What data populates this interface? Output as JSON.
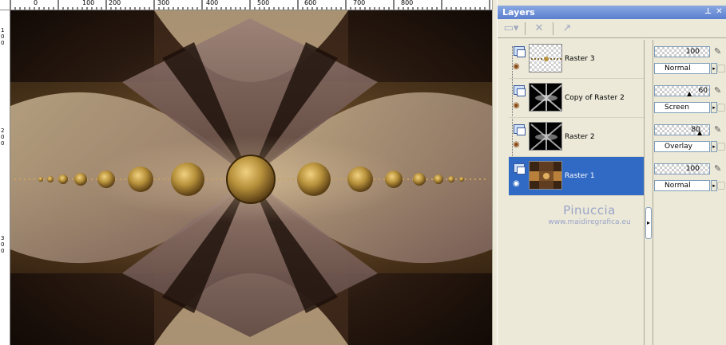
{
  "ruler": {
    "top_labels": [
      "0",
      "100",
      "200",
      "300",
      "400",
      "500",
      "600",
      "700",
      "800"
    ],
    "left_labels": [
      "1",
      "0",
      "0",
      "2",
      "0",
      "0",
      "3",
      "0",
      "0"
    ]
  },
  "panel": {
    "title": "Layers",
    "pin_icon": "pin-icon",
    "close_icon": "close-icon"
  },
  "toolbar": {
    "buttons": [
      "new-layer-icon",
      "delete-layer-icon",
      "layer-properties-icon"
    ]
  },
  "layers": [
    {
      "name": "Raster 3",
      "opacity": "100",
      "blend_mode": "Normal",
      "selected": false
    },
    {
      "name": "Copy of Raster 2",
      "opacity": "60",
      "blend_mode": "Screen",
      "selected": false
    },
    {
      "name": "Raster 2",
      "opacity": "80",
      "blend_mode": "Overlay",
      "selected": false
    },
    {
      "name": "Raster 1",
      "opacity": "100",
      "blend_mode": "Normal",
      "selected": true
    }
  ],
  "watermark": {
    "name": "Pinuccia",
    "url": "www.maidiregrafica.eu"
  },
  "colors": {
    "selection": "#316ac5",
    "titlebar": "#5a7fd0",
    "canvas_bg": "#1a0f0a",
    "gold": "#b8923c",
    "mauve": "#8a6f6a",
    "cream": "#e8d4a8"
  }
}
